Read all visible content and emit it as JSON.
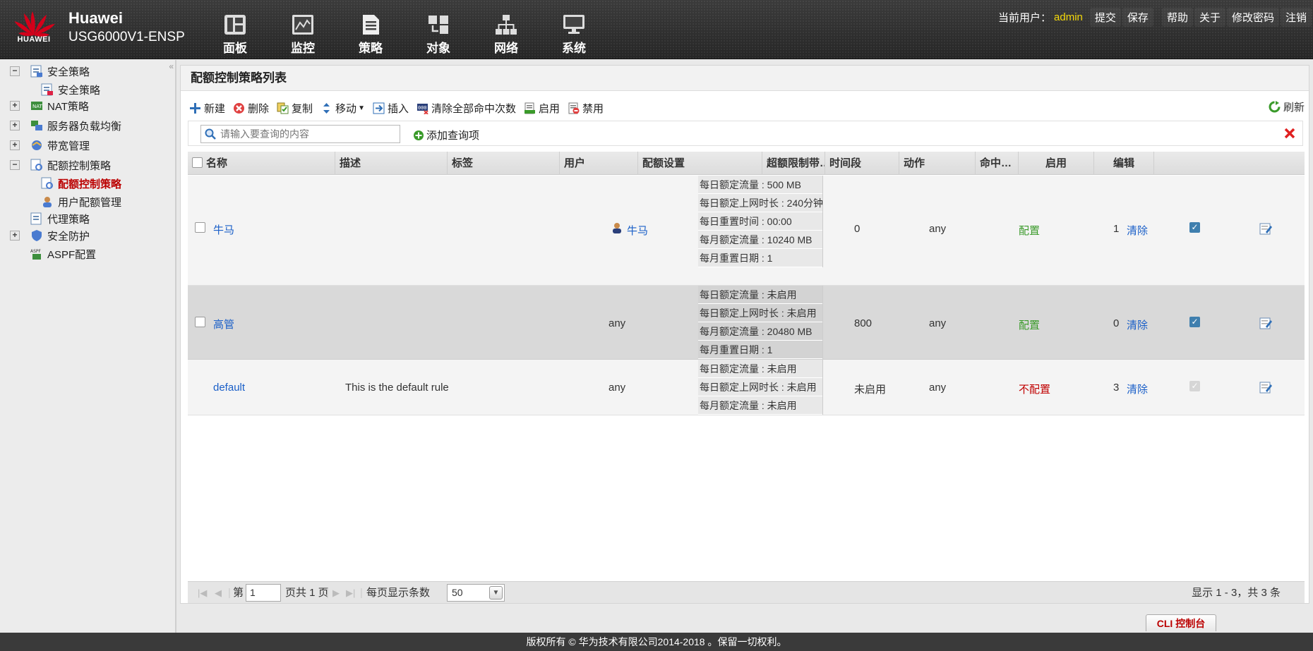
{
  "header": {
    "logo_text": "HUAWEI",
    "brand_line1": "Huawei",
    "brand_line2": "USG6000V1-ENSP",
    "nav": [
      {
        "label": "面板",
        "icon": "dashboard-icon"
      },
      {
        "label": "监控",
        "icon": "monitor-chart-icon"
      },
      {
        "label": "策略",
        "icon": "policy-doc-icon"
      },
      {
        "label": "对象",
        "icon": "object-icon"
      },
      {
        "label": "网络",
        "icon": "network-icon"
      },
      {
        "label": "系统",
        "icon": "system-monitor-icon"
      }
    ],
    "current_user_label": "当前用户：",
    "current_user": "admin",
    "actions": [
      "提交",
      "保存",
      "帮助",
      "关于",
      "修改密码",
      "注销"
    ]
  },
  "sidebar": {
    "items": [
      {
        "label": "安全策略",
        "toggle": "−",
        "level": 0
      },
      {
        "label": "安全策略",
        "toggle": "",
        "level": 1
      },
      {
        "label": "NAT策略",
        "toggle": "+",
        "level": 0
      },
      {
        "label": "服务器负载均衡",
        "toggle": "+",
        "level": 0
      },
      {
        "label": "带宽管理",
        "toggle": "+",
        "level": 0
      },
      {
        "label": "配额控制策略",
        "toggle": "−",
        "level": 0
      },
      {
        "label": "配额控制策略",
        "toggle": "",
        "level": 1,
        "active": true
      },
      {
        "label": "用户配额管理",
        "toggle": "",
        "level": 1
      },
      {
        "label": "代理策略",
        "toggle": "",
        "level": 0
      },
      {
        "label": "安全防护",
        "toggle": "+",
        "level": 0
      },
      {
        "label": "ASPF配置",
        "toggle": "",
        "level": 0
      }
    ]
  },
  "panel": {
    "title": "配额控制策略列表",
    "toolbar": {
      "new": "新建",
      "delete": "删除",
      "copy": "复制",
      "move": "移动",
      "insert": "插入",
      "clear_hits": "清除全部命中次数",
      "enable": "启用",
      "disable": "禁用",
      "refresh": "刷新"
    },
    "search_placeholder": "请输入要查询的内容",
    "add_query": "添加查询项"
  },
  "table": {
    "columns": [
      "名称",
      "描述",
      "标签",
      "用户",
      "配额设置",
      "超额限制带…",
      "时间段",
      "动作",
      "命中…",
      "启用",
      "编辑"
    ],
    "rows": [
      {
        "name": "牛马",
        "description": "",
        "tag": "",
        "user": "牛马",
        "quota": [
          "每日额定流量 : 500 MB",
          "每日额定上网时长 : 240分钟",
          "每日重置时间 : 00:00",
          "每月额定流量 : 10240 MB",
          "每月重置日期 : 1"
        ],
        "over_limit": "0",
        "time_range": "any",
        "action": "配置",
        "hits": "1",
        "clear": "清除",
        "enabled": true
      },
      {
        "name": "高管",
        "description": "",
        "tag": "",
        "user": "any",
        "quota": [
          "每日额定流量 : 未启用",
          "每日额定上网时长 : 未启用",
          "每月额定流量 : 20480 MB",
          "每月重置日期 : 1"
        ],
        "over_limit": "800",
        "time_range": "any",
        "action": "配置",
        "hits": "0",
        "clear": "清除",
        "enabled": true
      },
      {
        "name": "default",
        "description": "This is the default rule",
        "tag": "",
        "user": "any",
        "quota": [
          "每日额定流量 : 未启用",
          "每日额定上网时长 : 未启用",
          "每月额定流量 : 未启用"
        ],
        "over_limit": "未启用",
        "time_range": "any",
        "action": "不配置",
        "hits": "3",
        "clear": "清除",
        "enabled": true
      }
    ]
  },
  "pager": {
    "page_prefix": "第",
    "page_value": "1",
    "page_suffix": "页共 1 页",
    "per_page_label": "每页显示条数",
    "per_page_value": "50",
    "summary": "显示 1 - 3，共 3 条"
  },
  "cli_console": "CLI 控制台",
  "footer": "版权所有 © 华为技术有限公司2014-2018 。保留一切权利。",
  "colors": {
    "brand_red": "#d4001a",
    "user_yellow": "#f5d90a",
    "link_blue": "#1a5fc8",
    "action_green": "#3a9a2a",
    "action_red": "#c00000"
  }
}
